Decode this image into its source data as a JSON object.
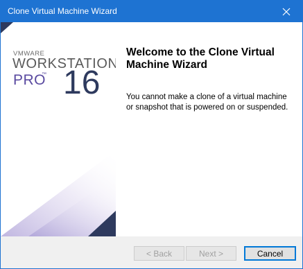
{
  "window": {
    "title": "Clone Virtual Machine Wizard",
    "accent_color": "#1e73d2",
    "close_icon": "close-icon"
  },
  "branding": {
    "vmware": "VMWARE",
    "product": "WORKSTATION",
    "edition": "PRO",
    "edition_mark": "™",
    "version": "16",
    "colors": {
      "navy": "#2e3a5e",
      "purple": "#5a4aa0",
      "lavender": "#cdc5e6"
    }
  },
  "content": {
    "heading": "Welcome to the Clone Virtual Machine Wizard",
    "description": "You cannot make a clone of a virtual machine or snapshot that is powered on or suspended."
  },
  "buttons": {
    "back": "< Back",
    "next": "Next >",
    "cancel": "Cancel"
  }
}
